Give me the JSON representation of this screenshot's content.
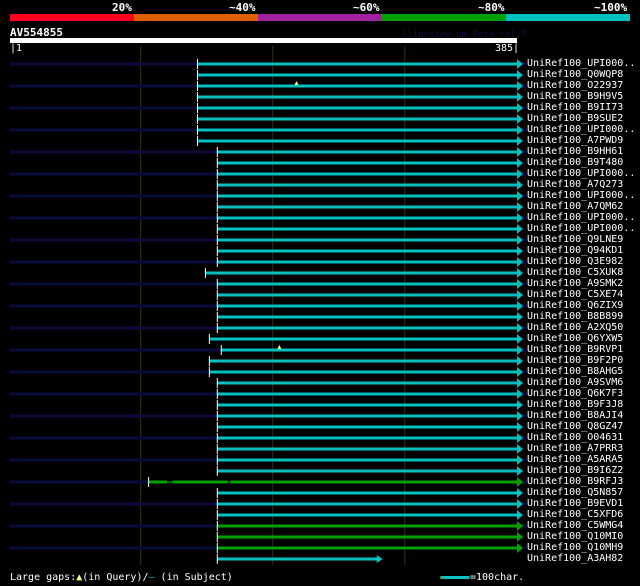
{
  "header": {
    "pct_labels": [
      "20%",
      "~40%",
      "~60%",
      "~80%",
      "~100%"
    ],
    "pct_colors": [
      "#ff0020",
      "#e06000",
      "#a020a0",
      "#00a000",
      "#00c0c0"
    ],
    "query_name": "AV554855",
    "watermark": "AlignView.pm Beta rel.7",
    "query_start": "|1",
    "query_end": "385|",
    "query_length": 385
  },
  "hits": [
    {
      "label": "UniRef100_UPI000..",
      "start": 143,
      "end": 385,
      "color": "cyan"
    },
    {
      "label": "UniRef100_Q0WQP8",
      "start": 143,
      "end": 385,
      "color": "cyan"
    },
    {
      "label": "UniRef100_O22937",
      "start": 143,
      "end": 385,
      "color": "cyan",
      "query_gap": 218
    },
    {
      "label": "UniRef100_B9H9V5",
      "start": 143,
      "end": 385,
      "color": "cyan"
    },
    {
      "label": "UniRef100_B9II73",
      "start": 143,
      "end": 385,
      "color": "cyan"
    },
    {
      "label": "UniRef100_B9SUE2",
      "start": 143,
      "end": 385,
      "color": "cyan"
    },
    {
      "label": "UniRef100_UPI000..",
      "start": 143,
      "end": 385,
      "color": "cyan"
    },
    {
      "label": "UniRef100_A7PWD9",
      "start": 143,
      "end": 385,
      "color": "cyan"
    },
    {
      "label": "UniRef100_B9HH61",
      "start": 158,
      "end": 385,
      "color": "cyan"
    },
    {
      "label": "UniRef100_B9T480",
      "start": 158,
      "end": 385,
      "color": "cyan"
    },
    {
      "label": "UniRef100_UPI000..",
      "start": 158,
      "end": 385,
      "color": "cyan"
    },
    {
      "label": "UniRef100_A7Q273",
      "start": 158,
      "end": 385,
      "color": "cyan"
    },
    {
      "label": "UniRef100_UPI000..",
      "start": 158,
      "end": 385,
      "color": "cyan"
    },
    {
      "label": "UniRef100_A7QM62",
      "start": 158,
      "end": 385,
      "color": "cyan"
    },
    {
      "label": "UniRef100_UPI000..",
      "start": 158,
      "end": 385,
      "color": "cyan"
    },
    {
      "label": "UniRef100_UPI000..",
      "start": 158,
      "end": 385,
      "color": "cyan"
    },
    {
      "label": "UniRef100_Q9LNE9",
      "start": 158,
      "end": 385,
      "color": "cyan"
    },
    {
      "label": "UniRef100_Q94KD1",
      "start": 158,
      "end": 385,
      "color": "cyan"
    },
    {
      "label": "UniRef100_Q3E982",
      "start": 158,
      "end": 385,
      "color": "cyan"
    },
    {
      "label": "UniRef100_C5XUK8",
      "start": 149,
      "end": 385,
      "color": "cyan"
    },
    {
      "label": "UniRef100_A9SMK2",
      "start": 158,
      "end": 385,
      "color": "cyan"
    },
    {
      "label": "UniRef100_C5XE74",
      "start": 158,
      "end": 385,
      "color": "cyan"
    },
    {
      "label": "UniRef100_Q6ZIX9",
      "start": 158,
      "end": 385,
      "color": "cyan"
    },
    {
      "label": "UniRef100_B8B899",
      "start": 158,
      "end": 385,
      "color": "cyan"
    },
    {
      "label": "UniRef100_A2XQ50",
      "start": 158,
      "end": 385,
      "color": "cyan"
    },
    {
      "label": "UniRef100_Q6YXW5",
      "start": 152,
      "end": 385,
      "color": "cyan"
    },
    {
      "label": "UniRef100_B9RVP1",
      "start": 161,
      "end": 385,
      "color": "cyan",
      "query_gap": 205
    },
    {
      "label": "UniRef100_B9F2P0",
      "start": 152,
      "end": 385,
      "color": "cyan"
    },
    {
      "label": "UniRef100_B8AHG5",
      "start": 152,
      "end": 385,
      "color": "cyan"
    },
    {
      "label": "UniRef100_A9SVM6",
      "start": 158,
      "end": 385,
      "color": "cyan"
    },
    {
      "label": "UniRef100_Q6K7F3",
      "start": 158,
      "end": 385,
      "color": "cyan"
    },
    {
      "label": "UniRef100_B9F3J8",
      "start": 158,
      "end": 385,
      "color": "cyan"
    },
    {
      "label": "UniRef100_B8AJI4",
      "start": 158,
      "end": 385,
      "color": "cyan"
    },
    {
      "label": "UniRef100_Q8GZ47",
      "start": 158,
      "end": 385,
      "color": "cyan"
    },
    {
      "label": "UniRef100_O04631",
      "start": 158,
      "end": 385,
      "color": "cyan"
    },
    {
      "label": "UniRef100_A7PRR3",
      "start": 158,
      "end": 385,
      "color": "cyan"
    },
    {
      "label": "UniRef100_A5ARA5",
      "start": 158,
      "end": 385,
      "color": "cyan"
    },
    {
      "label": "UniRef100_B9I6Z2",
      "start": 158,
      "end": 385,
      "color": "cyan"
    },
    {
      "label": "UniRef100_B9RFJ3",
      "start": 106,
      "end": 385,
      "color": "green",
      "segments": [
        [
          106,
          120
        ],
        [
          124,
          166
        ],
        [
          168,
          385
        ]
      ]
    },
    {
      "label": "UniRef100_Q5N857",
      "start": 158,
      "end": 385,
      "color": "cyan"
    },
    {
      "label": "UniRef100_B9EVD1",
      "start": 158,
      "end": 385,
      "color": "cyan"
    },
    {
      "label": "UniRef100_C5XFD6",
      "start": 158,
      "end": 385,
      "color": "cyan"
    },
    {
      "label": "UniRef100_C5WMG4",
      "start": 158,
      "end": 385,
      "color": "green"
    },
    {
      "label": "UniRef100_Q10MI0",
      "start": 158,
      "end": 385,
      "color": "green"
    },
    {
      "label": "UniRef100_Q10MH9",
      "start": 158,
      "end": 385,
      "color": "green"
    },
    {
      "label": "UniRef100_A3AH82",
      "start": 158,
      "end": 281,
      "color": "cyan"
    }
  ],
  "colors": {
    "cyan": "#00c0c0",
    "green": "#00a000",
    "navy": "#0a0a38",
    "grid": "#303018",
    "gap": "#ffff80"
  },
  "legend": {
    "large_gaps": "Large gaps:",
    "in_query": "(in Query)/",
    "in_subject": " (in Subject)",
    "scale": "=100char."
  }
}
